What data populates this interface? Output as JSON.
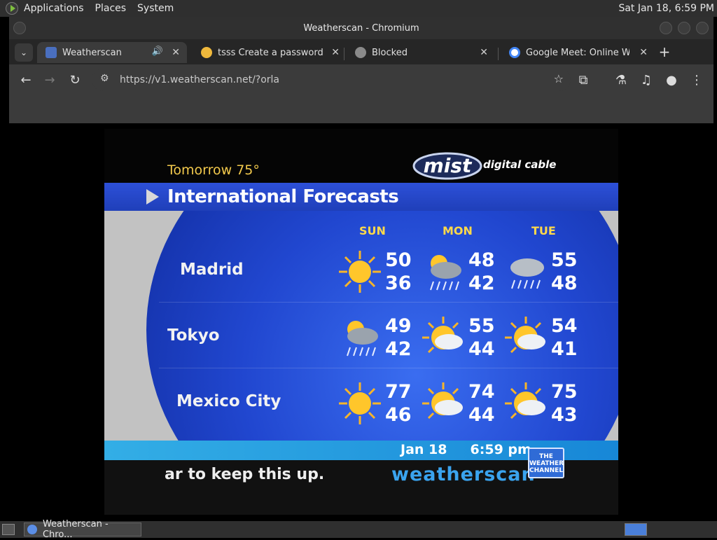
{
  "system_panel": {
    "menus": [
      "Applications",
      "Places",
      "System"
    ],
    "clock": "Sat Jan 18,  6:59 PM"
  },
  "window": {
    "title": "Weatherscan - Chromium"
  },
  "tabs": [
    {
      "title": "Weatherscan",
      "active": true,
      "icon": "weatherscan-favicon"
    },
    {
      "title": "tsss Create a password-p",
      "active": false,
      "icon": "emoji-favicon"
    },
    {
      "title": "Blocked",
      "active": false,
      "icon": "globe-favicon"
    },
    {
      "title": "Google Meet: Online Web",
      "active": false,
      "icon": "google-favicon"
    }
  ],
  "toolbar": {
    "url": "https://v1.weatherscan.net/?orla"
  },
  "weatherscan": {
    "tomorrow": "Tomorrow 75°",
    "logo_text": "mist",
    "digital_cable": "digital cable",
    "header_title": "International Forecasts",
    "days": [
      "SUN",
      "MON",
      "TUE"
    ],
    "rows": [
      {
        "city": "Madrid",
        "forecasts": [
          {
            "icon": "sunny-icon",
            "hi": "50",
            "lo": "36"
          },
          {
            "icon": "sun-rain-icon",
            "hi": "48",
            "lo": "42"
          },
          {
            "icon": "rain-icon",
            "hi": "55",
            "lo": "48"
          }
        ]
      },
      {
        "city": "Tokyo",
        "forecasts": [
          {
            "icon": "sun-rain-icon",
            "hi": "49",
            "lo": "42"
          },
          {
            "icon": "partly-cloudy-icon",
            "hi": "55",
            "lo": "44"
          },
          {
            "icon": "partly-cloudy-icon",
            "hi": "54",
            "lo": "41"
          }
        ]
      },
      {
        "city": "Mexico City",
        "forecasts": [
          {
            "icon": "sunny-icon",
            "hi": "77",
            "lo": "46"
          },
          {
            "icon": "partly-cloudy-icon",
            "hi": "74",
            "lo": "44"
          },
          {
            "icon": "partly-cloudy-icon",
            "hi": "75",
            "lo": "43"
          }
        ]
      }
    ],
    "date_time": "Jan 18     6:59 pm",
    "ticker": "ar to keep this up.",
    "brand": "weatherscan",
    "badge": "THE WEATHER CHANNEL"
  },
  "taskbar": {
    "item": "Weatherscan - Chro..."
  }
}
